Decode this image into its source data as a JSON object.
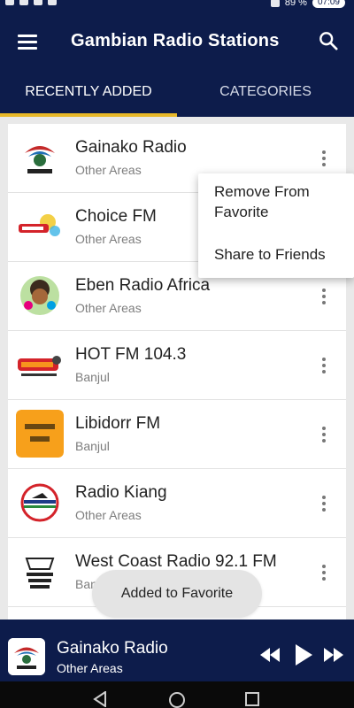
{
  "status": {
    "battery_percent": "89 %",
    "time": "07:09"
  },
  "app": {
    "title": "Gambian Radio Stations"
  },
  "tabs": [
    {
      "label": "RECENTLY ADDED",
      "active": true
    },
    {
      "label": "CATEGORIES",
      "active": false
    }
  ],
  "stations": [
    {
      "name": "Gainako Radio",
      "area": "Other Areas",
      "logo": "gainako-logo"
    },
    {
      "name": "Choice FM",
      "area": "Other Areas",
      "logo": "choice-fm-logo"
    },
    {
      "name": "Eben Radio Africa",
      "area": "Other Areas",
      "logo": "eben-radio-logo"
    },
    {
      "name": "HOT FM 104.3",
      "area": "Banjul",
      "logo": "hot-fm-logo"
    },
    {
      "name": "Libidorr FM",
      "area": "Banjul",
      "logo": "libidorr-logo"
    },
    {
      "name": "Radio Kiang",
      "area": "Other Areas",
      "logo": "radio-kiang-logo"
    },
    {
      "name": "West Coast Radio 92.1 FM",
      "area": "Banjul",
      "logo": "west-coast-logo"
    }
  ],
  "popup_menu": {
    "remove": "Remove From Favorite",
    "share": "Share to Friends"
  },
  "toast": "Added to Favorite",
  "player": {
    "name": "Gainako Radio",
    "area": "Other Areas"
  },
  "colors": {
    "primary": "#0d1c4b",
    "accent": "#e8b829"
  }
}
